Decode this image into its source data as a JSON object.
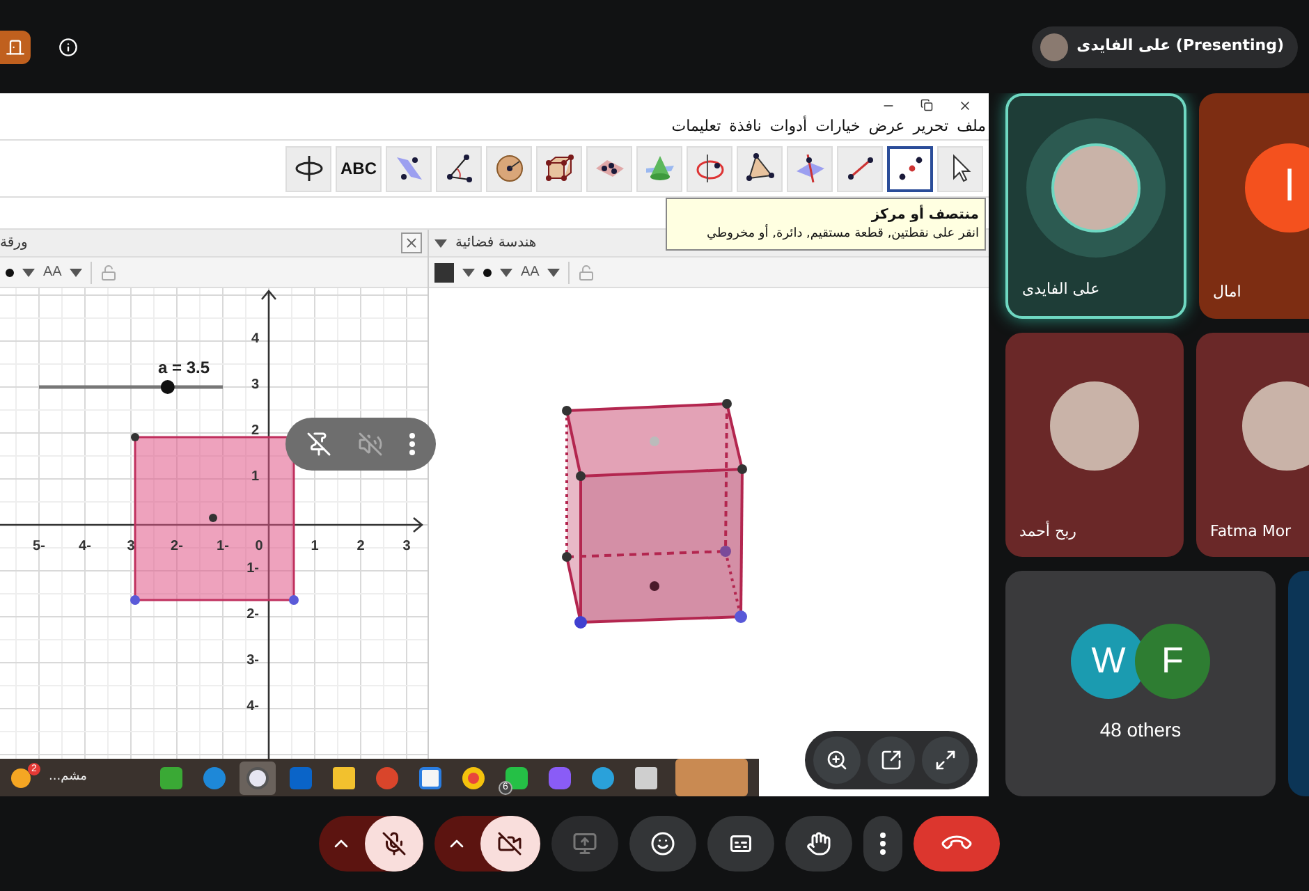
{
  "top_bar": {
    "presenter": {
      "label": "على الفايدى (Presenting)"
    }
  },
  "screen_share": {
    "menu": [
      "ملف",
      "تحرير",
      "عرض",
      "خيارات",
      "أدوات",
      "نافذة",
      "تعليمات"
    ],
    "tools": [
      {
        "kind": "rotate_view",
        "selected": false
      },
      {
        "kind": "text",
        "label": "ABC",
        "selected": false
      },
      {
        "kind": "reflect",
        "selected": false
      },
      {
        "kind": "angle",
        "selected": false
      },
      {
        "kind": "sphere",
        "selected": false
      },
      {
        "kind": "cube",
        "selected": false
      },
      {
        "kind": "plane",
        "selected": false
      },
      {
        "kind": "cone",
        "selected": false
      },
      {
        "kind": "circle_axis",
        "selected": false
      },
      {
        "kind": "polygon",
        "selected": false
      },
      {
        "kind": "perpendicular",
        "selected": false
      },
      {
        "kind": "segment",
        "selected": false
      },
      {
        "kind": "point",
        "selected": true
      },
      {
        "kind": "pointer",
        "selected": false
      }
    ],
    "tooltip": {
      "title": "منتصف أو مركز",
      "text": "انقر على نقطتين, قطعة مستقيم, دائرة, أو مخروطي"
    },
    "graphics_view": {
      "title": "ورقة",
      "text_style": "AA",
      "slider": {
        "label": "a = 3.5",
        "level": 0.7
      },
      "x_ticks": [
        "3",
        "2",
        "1",
        "0",
        "1-",
        "2-",
        "3",
        "4-",
        "5-"
      ],
      "y_ticks": [
        "4",
        "3",
        "2",
        "1",
        "1-",
        "2-",
        "3-",
        "4-"
      ]
    },
    "view_3d": {
      "title": "هندسة فضائية",
      "text_style": "AA"
    },
    "taskbar": {
      "widget": {
        "label": "مشم...",
        "badge": "2"
      },
      "apps": [
        {
          "kind": "editor",
          "selected": false
        },
        {
          "kind": "browser",
          "selected": false
        },
        {
          "kind": "geometry",
          "selected": true
        },
        {
          "kind": "mail",
          "selected": false
        },
        {
          "kind": "folder",
          "selected": false
        },
        {
          "kind": "slides",
          "selected": false
        },
        {
          "kind": "store",
          "selected": false
        },
        {
          "kind": "web",
          "selected": false
        },
        {
          "kind": "chat",
          "selected": false,
          "badge": "6"
        },
        {
          "kind": "assistant",
          "selected": false
        },
        {
          "kind": "messenger",
          "selected": false
        },
        {
          "kind": "tool",
          "selected": false
        }
      ]
    }
  },
  "participants": [
    {
      "kind": "person",
      "name": "على الفايدى",
      "speaking": true,
      "color": "#1e3d37"
    },
    {
      "kind": "person",
      "name": "امال",
      "letter": "ا",
      "speaking": false,
      "color": "#7d2d12"
    },
    {
      "kind": "person",
      "name": "ربح أحمد",
      "speaking": false,
      "color": "#6a2828"
    },
    {
      "kind": "person",
      "name": "Fatma Mor",
      "speaking": false,
      "color": "#6a2828"
    },
    {
      "kind": "others",
      "label": "48 others",
      "avatars": [
        {
          "letter": "F",
          "color": "#2e7d32"
        },
        {
          "letter": "W",
          "color": "#1b9bb0"
        }
      ],
      "color": "#3a3a3c"
    },
    {
      "kind": "blank",
      "color": "#0c3556"
    }
  ],
  "controls": {
    "mic_muted": true,
    "camera_off": true
  }
}
